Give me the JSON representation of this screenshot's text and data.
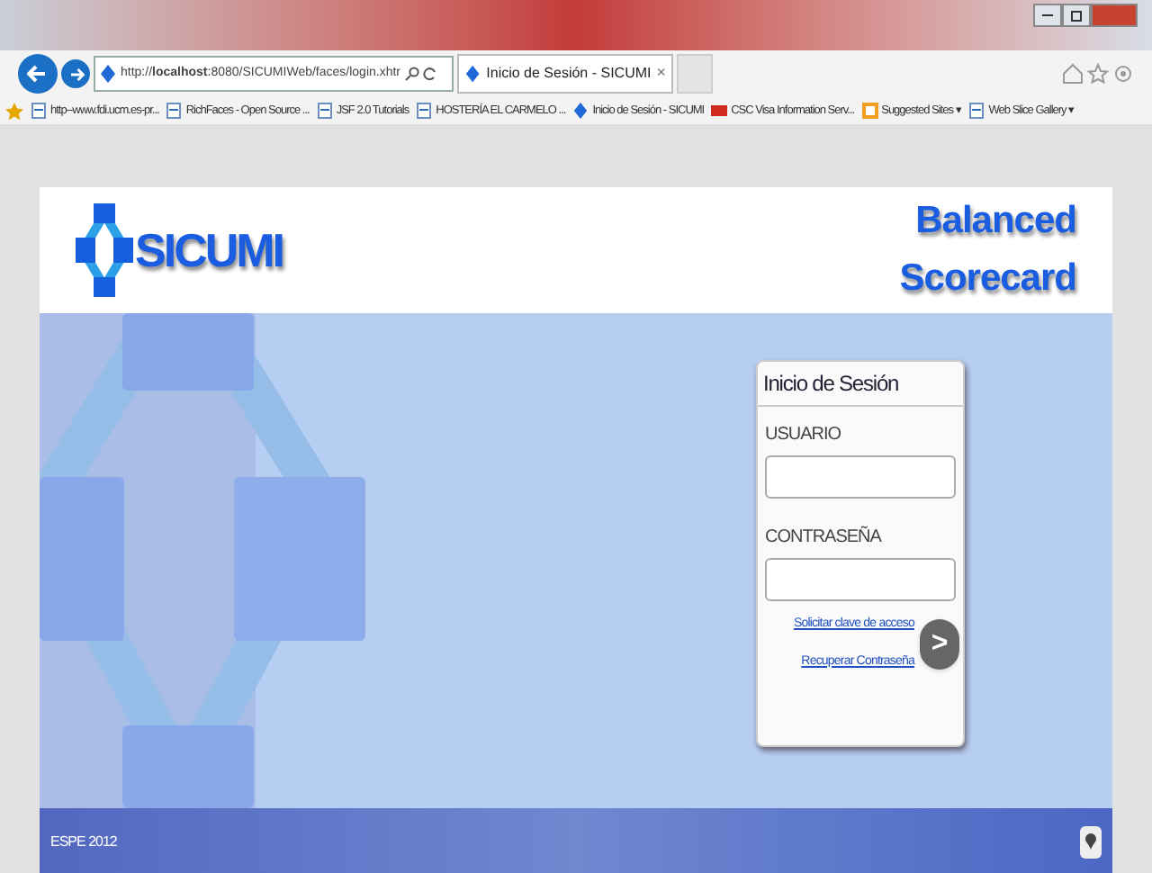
{
  "browser": {
    "address": "http://**localhost**:8080/SICUMIWeb/faces/login.xhtr",
    "tab": {
      "title": "Inicio de Sesión - SICUMI",
      "close": "×",
      "selected": true
    },
    "favorites": [
      {
        "label": "http--www.fdi.ucm.es-pr...",
        "kind": "page"
      },
      {
        "label": "RichFaces - Open Source ...",
        "kind": "page"
      },
      {
        "label": "JSF 2.0 Tutorials",
        "kind": "page"
      },
      {
        "label": "HOSTERÍA EL CARMELO ...",
        "kind": "page"
      },
      {
        "label": "Inicio de Sesión - SICUMI",
        "kind": "site"
      },
      {
        "label": "CSC Visa Information Serv...",
        "kind": "mail"
      },
      {
        "label": "Suggested Sites ▾",
        "kind": "suggested"
      },
      {
        "label": "Web Slice Gallery ▾",
        "kind": "page"
      }
    ]
  },
  "header": {
    "logo": "SICUMI",
    "title_lines": [
      "Balanced",
      "Scorecard"
    ]
  },
  "login": {
    "title": "Inicio de Sesión",
    "fields": [
      {
        "label": "USUARIO"
      },
      {
        "label": "CONTRASEÑA"
      }
    ],
    "links": [
      "Solicitar clave de acceso",
      "Recuperar Contraseña"
    ],
    "submit": ">"
  },
  "footer": {
    "text": "ESPE 2012"
  }
}
